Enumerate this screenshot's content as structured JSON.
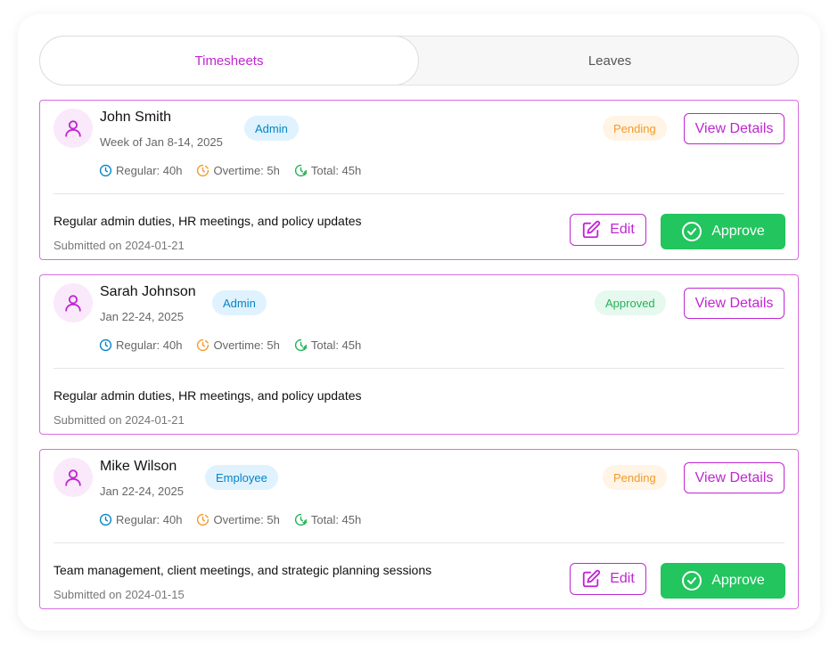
{
  "tabs": [
    {
      "label": "Timesheets",
      "active": true
    },
    {
      "label": "Leaves",
      "active": false
    }
  ],
  "colors": {
    "accent": "#c026d3",
    "approve": "#22c55e",
    "regular_icon": "#0284c7",
    "overtime_icon": "#f29a2e",
    "total_icon": "#22b357"
  },
  "labels": {
    "view_details": "View Details",
    "edit": "Edit",
    "approve": "Approve"
  },
  "entries": [
    {
      "name": "John Smith",
      "period": "Week of Jan 8-14, 2025",
      "role": "Admin",
      "status": "Pending",
      "regular": "Regular: 40h",
      "overtime": "Overtime: 5h",
      "total": "Total: 45h",
      "description": "Regular admin duties, HR meetings, and policy updates",
      "submitted": "Submitted on 2024-01-21"
    },
    {
      "name": "Sarah Johnson",
      "period": "Jan 22-24, 2025",
      "role": "Admin",
      "status": "Approved",
      "regular": "Regular: 40h",
      "overtime": "Overtime: 5h",
      "total": "Total: 45h",
      "description": "Regular admin duties, HR meetings, and policy updates",
      "submitted": "Submitted on 2024-01-21"
    },
    {
      "name": "Mike Wilson",
      "period": "Jan 22-24, 2025",
      "role": "Employee",
      "status": "Pending",
      "regular": "Regular: 40h",
      "overtime": "Overtime: 5h",
      "total": "Total: 45h",
      "description": "Team management, client meetings, and strategic planning sessions",
      "submitted": "Submitted on 2024-01-15"
    }
  ]
}
